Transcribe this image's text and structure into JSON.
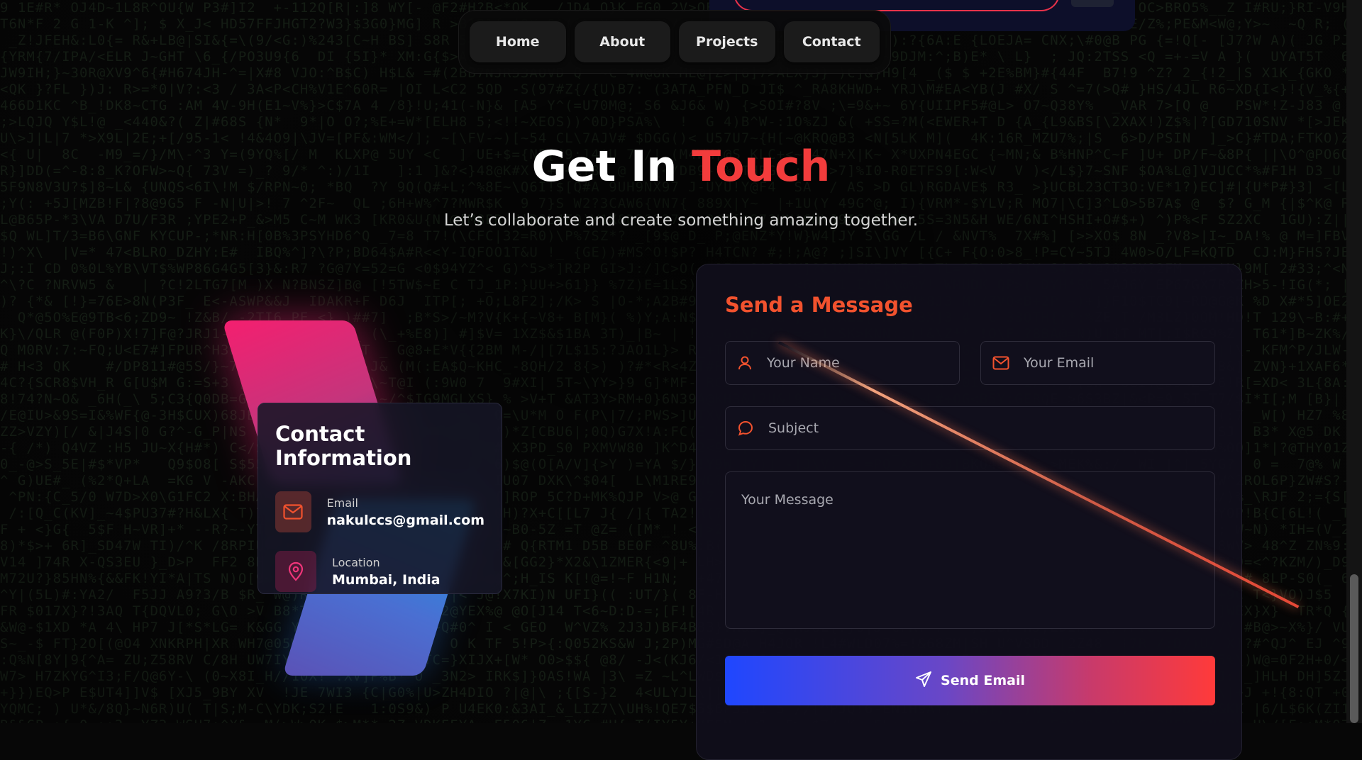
{
  "nav": {
    "items": [
      {
        "label": "Home"
      },
      {
        "label": "About"
      },
      {
        "label": "Projects"
      },
      {
        "label": "Contact"
      }
    ]
  },
  "hero": {
    "title_main": "Get In ",
    "title_accent": "Touch",
    "subtitle": "Let’s collaborate and create something amazing together."
  },
  "contact_info": {
    "heading": "Contact Information",
    "items": [
      {
        "label": "Email",
        "value": "nakulccs@gmail.com",
        "icon": "mail-icon"
      },
      {
        "label": "Location",
        "value": "Mumbai, India",
        "icon": "location-pin-icon"
      }
    ]
  },
  "form": {
    "heading": "Send a Message",
    "name_placeholder": "Your Name",
    "email_placeholder": "Your Email",
    "subject_placeholder": "Subject",
    "message_placeholder": "Your Message",
    "submit_label": "Send Email"
  },
  "colors": {
    "accent_red": "#f23c3c",
    "form_title_orange": "#f2522e",
    "button_gradient_start": "#1f47ff",
    "button_gradient_end": "#ff3a3a"
  }
}
